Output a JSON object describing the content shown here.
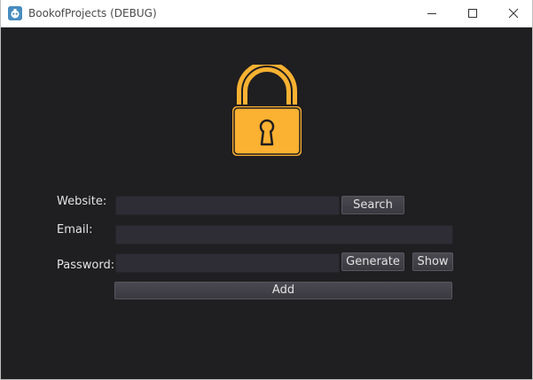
{
  "window": {
    "title": "BookofProjects (DEBUG)",
    "app_icon": "godot-engine-icon",
    "controls": {
      "minimize_icon": "minimize-icon",
      "maximize_icon": "maximize-icon",
      "close_icon": "close-icon"
    }
  },
  "logo": {
    "icon": "padlock-icon",
    "color": "#fbb131"
  },
  "form": {
    "website_label": "Website:",
    "website_value": "",
    "search_label": "Search",
    "email_label": "Email:",
    "email_value": "",
    "password_label": "Password:",
    "password_value": "",
    "generate_label": "Generate",
    "show_label": "Show",
    "add_label": "Add"
  },
  "colors": {
    "background": "#1f1e21",
    "field": "#2e2c34",
    "button": "#413f46",
    "accent": "#fbb131"
  }
}
